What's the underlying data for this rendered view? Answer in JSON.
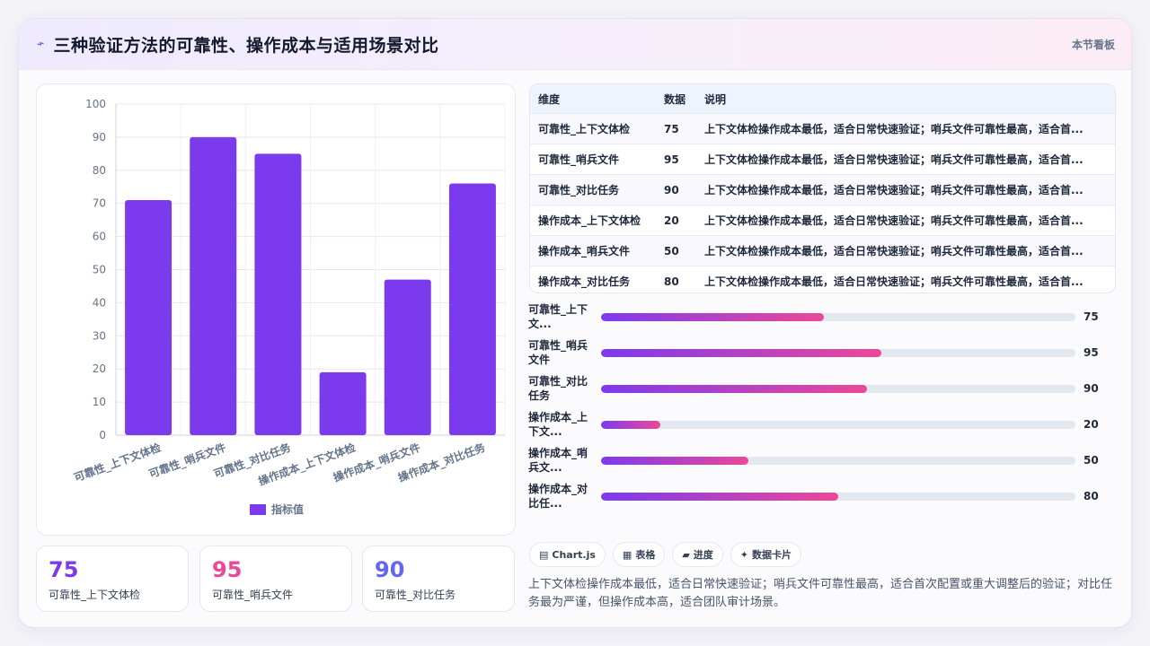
{
  "header": {
    "title": "三种验证方法的可靠性、操作成本与适用场景对比",
    "board_label": "本节看板"
  },
  "chart_data": {
    "type": "bar",
    "categories": [
      "可靠性_上下文体检",
      "可靠性_哨兵文件",
      "可靠性_对比任务",
      "操作成本_上下文体检",
      "操作成本_哨兵文件",
      "操作成本_对比任务"
    ],
    "series": [
      {
        "name": "指标值",
        "values": [
          71,
          90,
          85,
          19,
          47,
          76
        ]
      }
    ],
    "ylim": [
      0,
      100
    ],
    "yticks": [
      0,
      10,
      20,
      30,
      40,
      50,
      60,
      70,
      80,
      90,
      100
    ],
    "grid": true,
    "legend_position": "bottom",
    "bar_color": "#7c3aed"
  },
  "stats": [
    {
      "value": "75",
      "label": "可靠性_上下文体检",
      "color": "#7c3aed"
    },
    {
      "value": "95",
      "label": "可靠性_哨兵文件",
      "color": "#ec4899"
    },
    {
      "value": "90",
      "label": "可靠性_对比任务",
      "color": "#6366f1"
    }
  ],
  "table": {
    "headers": [
      "维度",
      "数据",
      "说明"
    ],
    "rows": [
      {
        "dim": "可靠性_上下文体检",
        "val": "75",
        "desc": "上下文体检操作成本最低，适合日常快速验证；哨兵文件可靠性最高，适合首..."
      },
      {
        "dim": "可靠性_哨兵文件",
        "val": "95",
        "desc": "上下文体检操作成本最低，适合日常快速验证；哨兵文件可靠性最高，适合首..."
      },
      {
        "dim": "可靠性_对比任务",
        "val": "90",
        "desc": "上下文体检操作成本最低，适合日常快速验证；哨兵文件可靠性最高，适合首..."
      },
      {
        "dim": "操作成本_上下文体检",
        "val": "20",
        "desc": "上下文体检操作成本最低，适合日常快速验证；哨兵文件可靠性最高，适合首..."
      },
      {
        "dim": "操作成本_哨兵文件",
        "val": "50",
        "desc": "上下文体检操作成本最低，适合日常快速验证；哨兵文件可靠性最高，适合首..."
      },
      {
        "dim": "操作成本_对比任务",
        "val": "80",
        "desc": "上下文体检操作成本最低，适合日常快速验证；哨兵文件可靠性最高，适合首..."
      }
    ]
  },
  "progress": [
    {
      "label": "可靠性_上下文...",
      "value": "75",
      "fraction": 0.47
    },
    {
      "label": "可靠性_哨兵文件",
      "value": "95",
      "fraction": 0.59
    },
    {
      "label": "可靠性_对比任务",
      "value": "90",
      "fraction": 0.56
    },
    {
      "label": "操作成本_上下文...",
      "value": "20",
      "fraction": 0.125
    },
    {
      "label": "操作成本_哨兵文...",
      "value": "50",
      "fraction": 0.31
    },
    {
      "label": "操作成本_对比任...",
      "value": "80",
      "fraction": 0.5
    }
  ],
  "chips": [
    {
      "icon": "▤",
      "label": "Chart.js"
    },
    {
      "icon": "▦",
      "label": "表格"
    },
    {
      "icon": "▰",
      "label": "进度"
    },
    {
      "icon": "✦",
      "label": "数据卡片"
    }
  ],
  "description": "上下文体检操作成本最低，适合日常快速验证；哨兵文件可靠性最高，适合首次配置或重大调整后的验证；对比任务最为严谨，但操作成本高，适合团队审计场景。"
}
